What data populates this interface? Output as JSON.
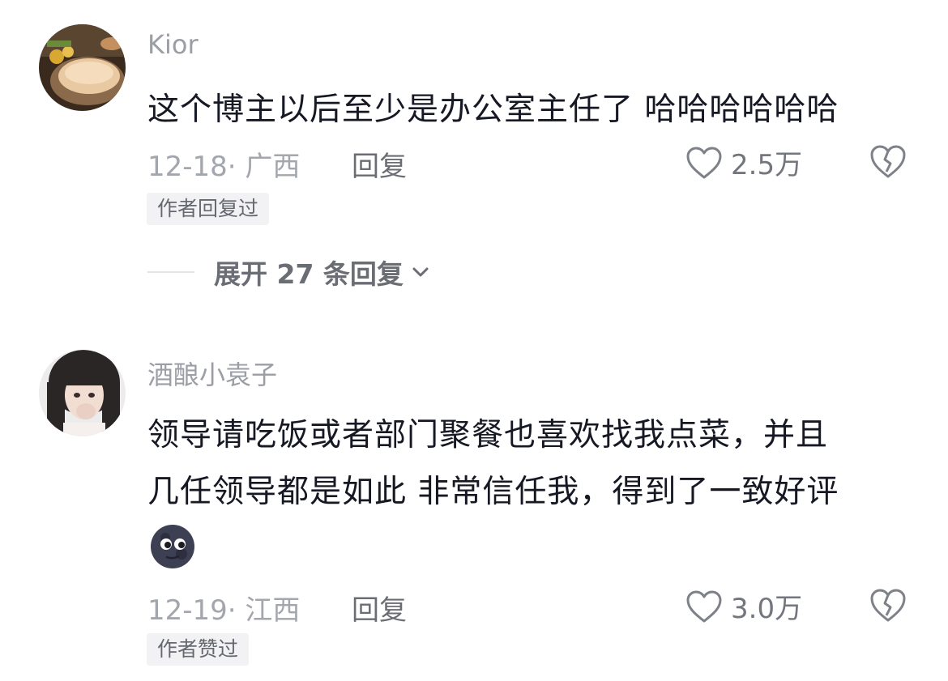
{
  "comments": [
    {
      "username": "Kior",
      "text_lines": [
        "这个博主以后至少是办公室主任了 哈哈哈哈哈哈"
      ],
      "date_location": "12-18· 广西",
      "reply_label": "回复",
      "like_count": "2.5万",
      "author_badge": "作者回复过",
      "expand_replies": "展开 27 条回复"
    },
    {
      "username": "酒酿小袁子",
      "text_lines": [
        "领导请吃饭或者部门聚餐也喜欢找我点菜，并且",
        "几任领导都是如此 非常信任我，得到了一致好评"
      ],
      "emoji": "new-moon-face-emoji",
      "date_location": "12-19· 江西",
      "reply_label": "回复",
      "like_count": "3.0万",
      "author_badge": "作者赞过"
    }
  ],
  "icons": {
    "like": "heart-outline-icon",
    "dislike": "broken-heart-icon",
    "expand": "chevron-down-icon"
  },
  "colors": {
    "username": "#9b9ea5",
    "text": "#161823",
    "meta": "#a3a6ad",
    "badge_bg": "#f2f2f4"
  }
}
